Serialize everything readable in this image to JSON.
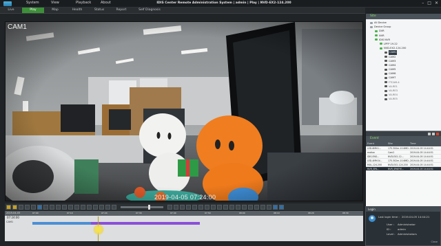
{
  "window": {
    "title": "IDIS Center Remote Administration System | admin | Play | NVD-EX2-124.200",
    "controls": [
      "–",
      "□",
      "✕"
    ]
  },
  "menu": [
    "System",
    "View",
    "Playback",
    "About"
  ],
  "tabs": [
    "Live",
    "Play",
    "Map",
    "Health",
    "Status",
    "Report",
    "Self Diagnosis"
  ],
  "active_tab": "Play",
  "video": {
    "camera_label": "CAM1",
    "osd_timestamp": "2019-04-05  07:24:00"
  },
  "timeline": {
    "header_date": "2019-04-05",
    "current_time": "07:24:00",
    "camera_row": "CAM1",
    "ruler_labels": [
      "07:00",
      "07:10",
      "07:20",
      "07:30",
      "07:40",
      "07:50",
      "08:00",
      "08:10",
      "08:20",
      "08:30"
    ]
  },
  "site_panel": {
    "title": "Site",
    "tree": [
      {
        "label": "All Device",
        "level": 0,
        "color": "#9aa0a5"
      },
      {
        "label": "Device Group",
        "level": 0,
        "color": "#9aa0a5"
      },
      {
        "label": "DVR",
        "level": 1,
        "color": "#4bb34b"
      },
      {
        "label": "NVR",
        "level": 1,
        "color": "#4bb34b"
      },
      {
        "label": "IDIS NVR",
        "level": 1,
        "color": "#4bb34b"
      },
      {
        "label": "LPFP 19.22",
        "level": 2,
        "color": "#4bb34b"
      },
      {
        "label": "NVD-EX2-124.200",
        "level": 2,
        "color": "#4bb34b"
      },
      {
        "label": "CAM1",
        "level": 3,
        "color": "#555",
        "selected": true
      },
      {
        "label": "CAM2",
        "level": 3,
        "color": "#555"
      },
      {
        "label": "CAM3",
        "level": 3,
        "color": "#555"
      },
      {
        "label": "CAM4",
        "level": 3,
        "color": "#555"
      },
      {
        "label": "CAM5",
        "level": 3,
        "color": "#555"
      },
      {
        "label": "CAM6",
        "level": 3,
        "color": "#555"
      },
      {
        "label": "CAM7",
        "level": 3,
        "color": "#555"
      },
      {
        "label": "FTCAM-4",
        "level": 3,
        "color": "#555",
        "dim": true
      },
      {
        "label": "VA-RE1",
        "level": 3,
        "color": "#555",
        "dim": true
      },
      {
        "label": "VA-RE3",
        "level": 3,
        "color": "#555",
        "dim": true
      },
      {
        "label": "VA-RE4",
        "level": 3,
        "color": "#555",
        "dim": true
      },
      {
        "label": "VA-RE5",
        "level": 3,
        "color": "#555",
        "dim": true
      }
    ]
  },
  "event_panel": {
    "title": "Event",
    "columns": [
      "Event",
      "Site",
      "Time"
    ],
    "rows": [
      {
        "event": "LED-6MM-I...",
        "site": "175.300m-10.6MD...",
        "time": "2019-04-05 14:44:51",
        "dark": false
      },
      {
        "event": "motion",
        "site": "Cam2",
        "time": "2019-04-05 14:44:51",
        "dark": false
      },
      {
        "event": "IDIS-ENG...",
        "site": "NVD-EX2-12...",
        "time": "2019-04-05 14:44:51",
        "dark": false
      },
      {
        "event": "LED-4MM-N...",
        "site": "175.302m-10.6MD...",
        "time": "2019-04-05 14:44:51",
        "dark": false
      },
      {
        "event": "MUL-124.200",
        "site": "NVD-EX2-124.200",
        "time": "2019-04-05 14:44:51",
        "dark": false
      },
      {
        "event": "NVR_SPA...",
        "site": "NVR_SPAEYE...",
        "time": "2019-04-05 14:44:51",
        "dark": true
      }
    ]
  },
  "login_popup": {
    "title": "Login",
    "last_login_label": "Last login time :",
    "last_login_value": "2019-04-05 14:44:21",
    "user_label": "User :",
    "user_value": "Administrator",
    "id_label": "ID :",
    "id_value": "admin",
    "level_label": "Level :",
    "level_value": "Administrators",
    "close_label": "Close"
  },
  "colors": {
    "active_tab": "#3d8f39",
    "timeline_record_normal": "#4b8fd6",
    "timeline_record_event": "#8a4fd8",
    "cursor_highlight": "#f5e24a"
  }
}
